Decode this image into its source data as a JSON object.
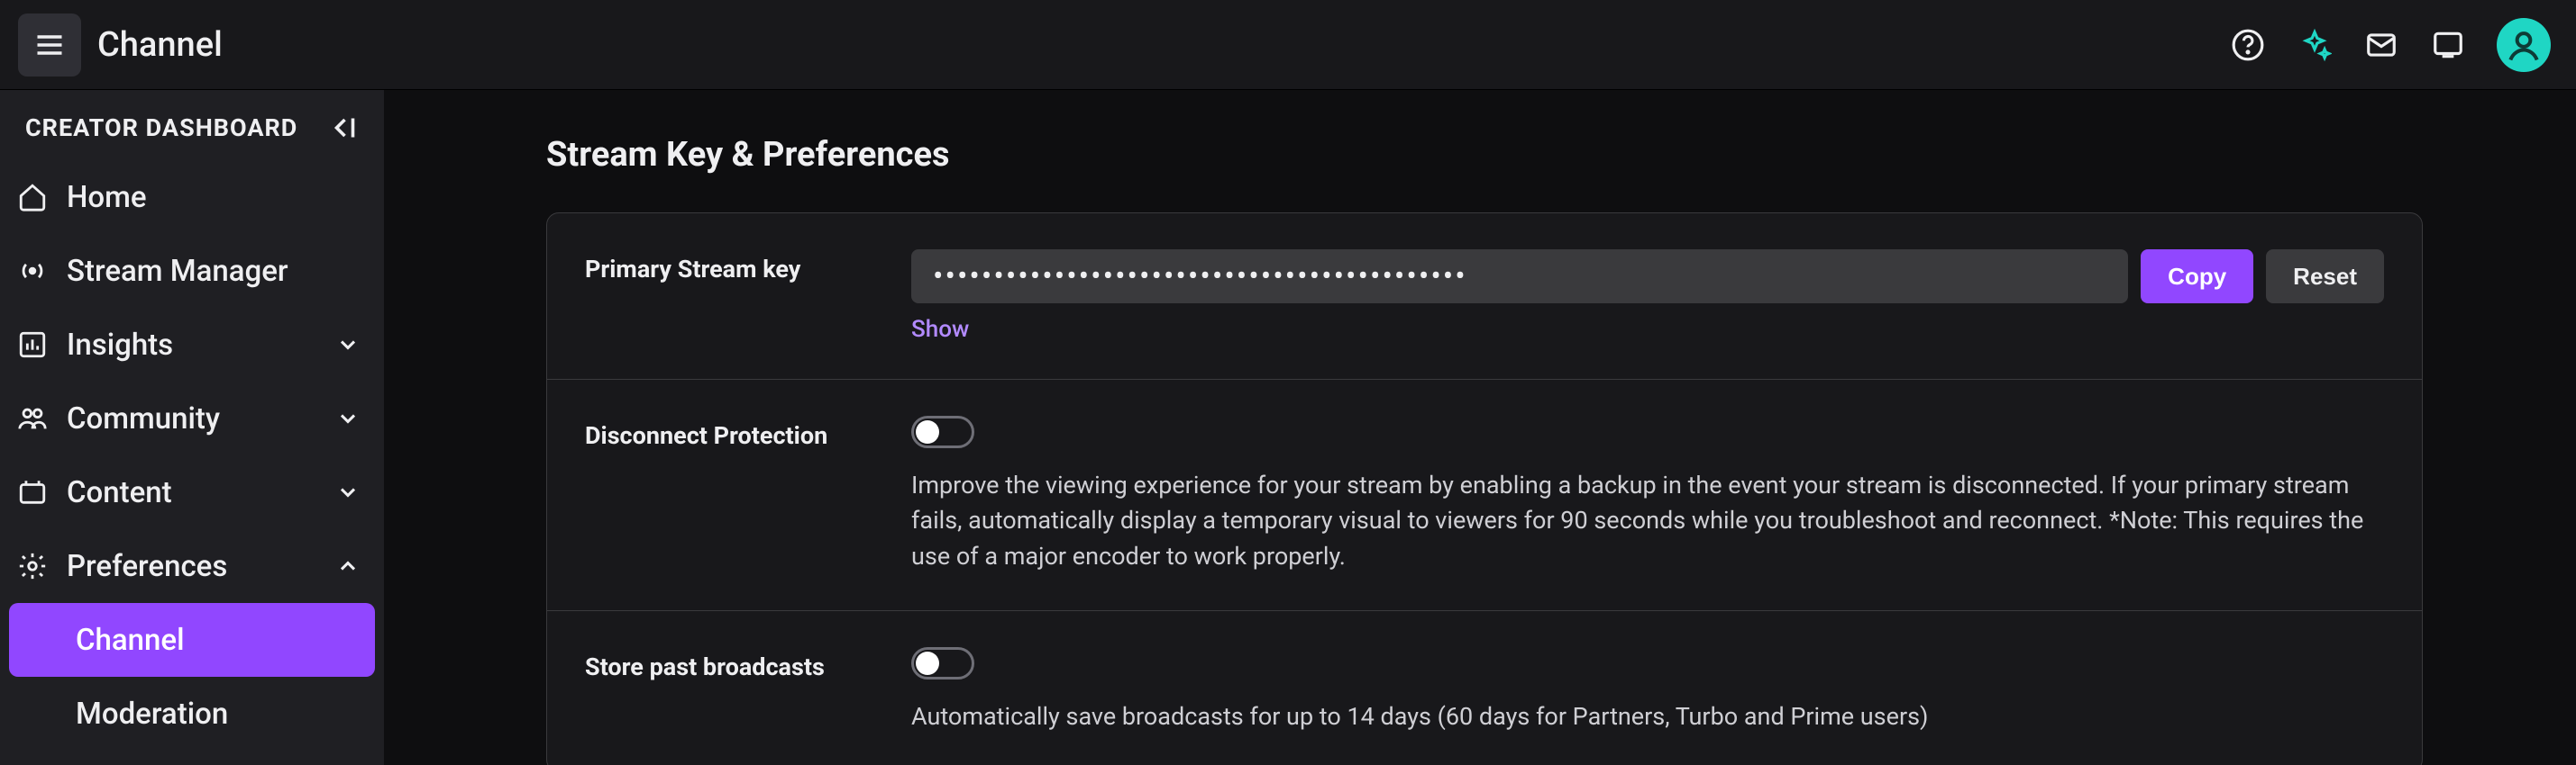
{
  "header": {
    "title": "Channel"
  },
  "sidebar": {
    "title": "CREATOR DASHBOARD",
    "items": {
      "home": "Home",
      "stream_manager": "Stream Manager",
      "insights": "Insights",
      "community": "Community",
      "content": "Content",
      "preferences": "Preferences"
    },
    "sub": {
      "channel": "Channel",
      "moderation": "Moderation"
    }
  },
  "page": {
    "title": "Stream Key & Preferences"
  },
  "stream_key": {
    "label": "Primary Stream key",
    "value": "••••••••••••••••••••••••••••••••••••••••••••",
    "copy": "Copy",
    "reset": "Reset",
    "show": "Show"
  },
  "disconnect": {
    "label": "Disconnect Protection",
    "desc": "Improve the viewing experience for your stream by enabling a backup in the event your stream is disconnected. If your primary stream fails, automatically display a temporary visual to viewers for 90 seconds while you troubleshoot and reconnect. *Note: This requires the use of a major encoder to work properly."
  },
  "store": {
    "label": "Store past broadcasts",
    "desc": "Automatically save broadcasts for up to 14 days (60 days for Partners, Turbo and Prime users)"
  },
  "colors": {
    "accent": "#9147ff"
  }
}
